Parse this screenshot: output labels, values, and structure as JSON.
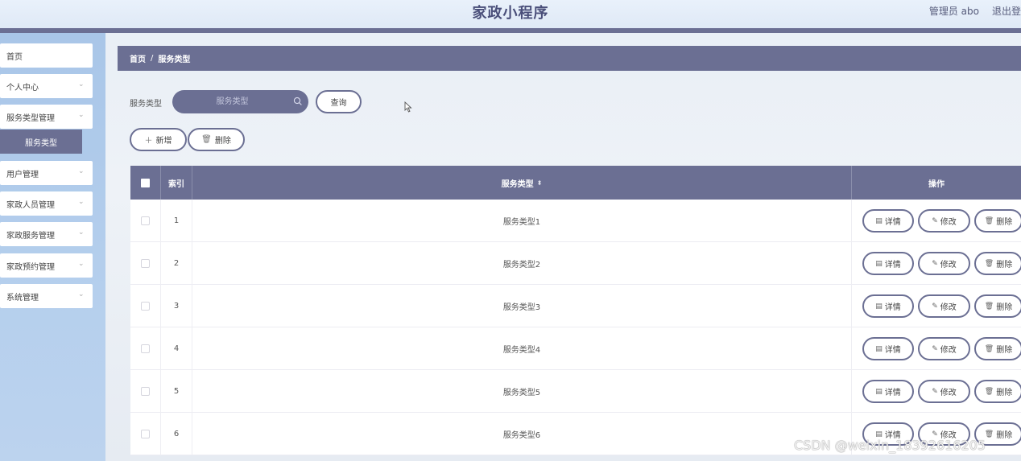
{
  "header": {
    "title": "家政小程序",
    "user": "管理员 abo",
    "logout": "退出登录"
  },
  "sidebar": {
    "items": [
      {
        "label": "首页"
      },
      {
        "label": "个人中心"
      },
      {
        "label": "服务类型管理"
      },
      {
        "label": "服务类型"
      },
      {
        "label": "用户管理"
      },
      {
        "label": "家政人员管理"
      },
      {
        "label": "家政服务管理"
      },
      {
        "label": "家政预约管理"
      },
      {
        "label": "系统管理"
      }
    ]
  },
  "breadcrumb": {
    "home": "首页",
    "separator": "/",
    "current": "服务类型"
  },
  "search": {
    "label": "服务类型",
    "placeholder": "服务类型",
    "query_button": "查询"
  },
  "toolbar": {
    "add_label": "新增",
    "delete_label": "删除"
  },
  "table": {
    "columns": {
      "index": "索引",
      "type": "服务类型",
      "actions": "操作"
    },
    "rows": [
      {
        "index": "1",
        "type": "服务类型1"
      },
      {
        "index": "2",
        "type": "服务类型2"
      },
      {
        "index": "3",
        "type": "服务类型3"
      },
      {
        "index": "4",
        "type": "服务类型4"
      },
      {
        "index": "5",
        "type": "服务类型5"
      },
      {
        "index": "6",
        "type": "服务类型6"
      }
    ],
    "row_actions": {
      "detail": "详情",
      "edit": "修改",
      "delete": "删除"
    }
  },
  "watermark": "CSDN @weixin_18392616205",
  "colors": {
    "accent": "#6b6f93",
    "sidebar": "#b5cfed"
  }
}
